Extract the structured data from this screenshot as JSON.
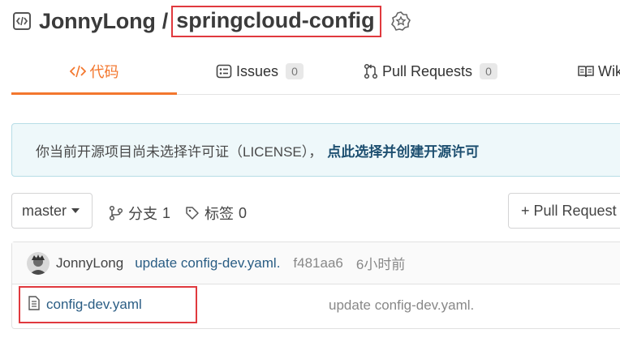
{
  "header": {
    "owner": "JonnyLong",
    "separator": "/",
    "repo_name": "springcloud-config"
  },
  "tabs": [
    {
      "label": "代码",
      "icon": "code-icon",
      "active": true
    },
    {
      "label": "Issues",
      "icon": "issues-icon",
      "count": "0"
    },
    {
      "label": "Pull Requests",
      "icon": "pull-request-icon",
      "count": "0"
    },
    {
      "label": "Wiki",
      "icon": "wiki-icon"
    }
  ],
  "notice": {
    "text": "你当前开源项目尚未选择许可证（LICENSE），",
    "link": "点此选择并创建开源许可"
  },
  "branch_bar": {
    "branch": "master",
    "branches_label": "分支",
    "branches_count": "1",
    "tags_label": "标签",
    "tags_count": "0",
    "pull_request_button": "+ Pull Request"
  },
  "latest_commit": {
    "author": "JonnyLong",
    "message": "update config-dev.yaml.",
    "hash": "f481aa6",
    "time": "6小时前"
  },
  "files": [
    {
      "name": "config-dev.yaml",
      "icon": "file-icon",
      "commit_message": "update config-dev.yaml."
    }
  ],
  "colors": {
    "accent": "#f3772e",
    "highlight_box": "#e0393e",
    "link": "#2a5d84",
    "notice_bg": "#eef8fa"
  }
}
